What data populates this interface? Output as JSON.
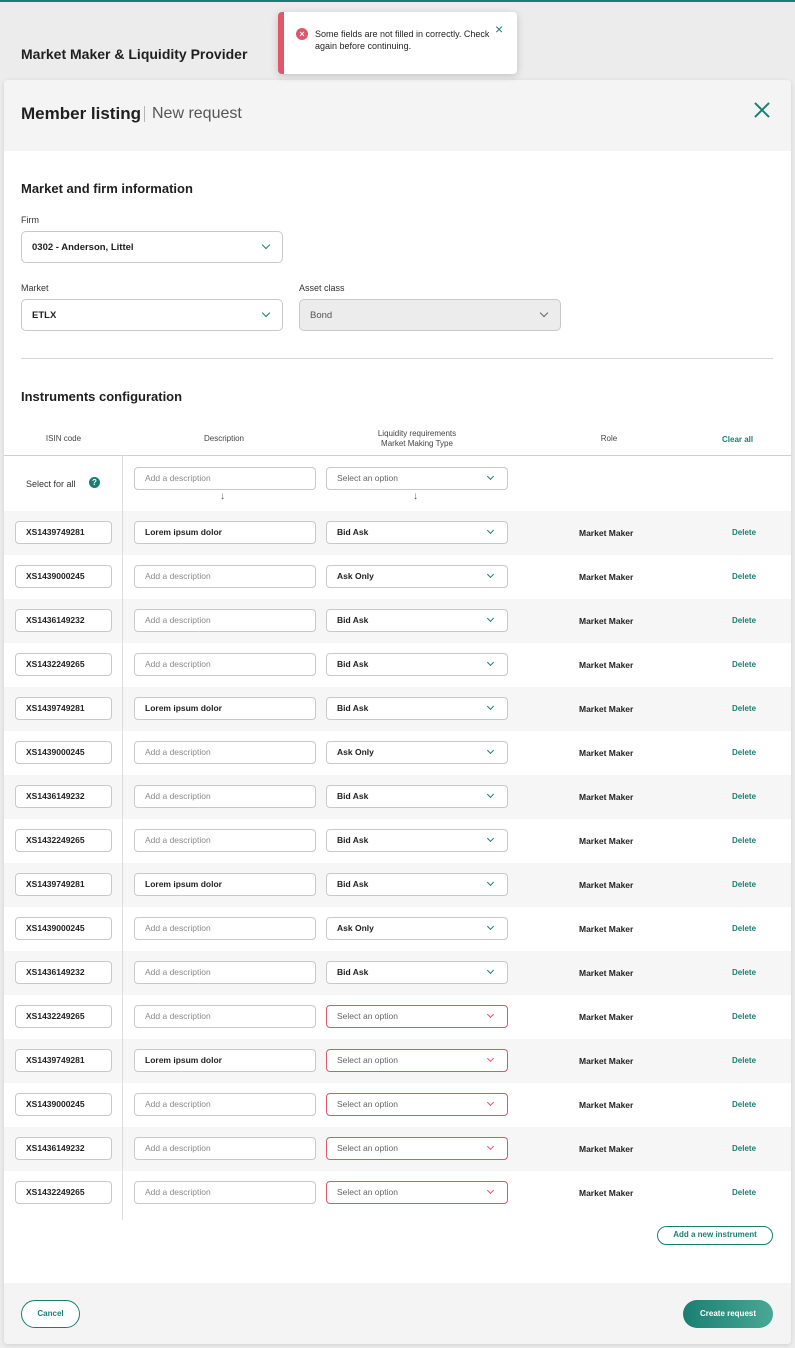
{
  "page": {
    "title": "Market Maker & Liquidity Provider"
  },
  "toast": {
    "message": "Some fields are not filled in correctly. Check again before continuing.",
    "error_icon": "×",
    "close_icon": "×"
  },
  "modal": {
    "title": "Member listing",
    "subtitle": "New request"
  },
  "market_firm": {
    "section_title": "Market and firm information",
    "firm_label": "Firm",
    "firm_value": "0302 - Anderson, Littel",
    "market_label": "Market",
    "market_value": "ETLX",
    "asset_label": "Asset class",
    "asset_value": "Bond"
  },
  "instruments": {
    "section_title": "Instruments configuration",
    "headers": {
      "isin": "ISIN code",
      "description": "Description",
      "liquidity_line1": "Liquidity requirements",
      "liquidity_line2": "Market Making Type",
      "role": "Role",
      "clear_all": "Clear all"
    },
    "select_all": {
      "label": "Select for all",
      "help_icon": "?",
      "desc_placeholder": "Add a description",
      "type_placeholder": "Select an option",
      "arrow": "↓"
    },
    "rows": [
      {
        "isin": "XS1439749281",
        "description": "Lorem ipsum dolor",
        "type": "Bid Ask",
        "role": "Market Maker",
        "delete": "Delete"
      },
      {
        "isin": "XS1439000245",
        "description": "Add a description",
        "type": "Ask Only",
        "role": "Market Maker",
        "delete": "Delete"
      },
      {
        "isin": "XS1436149232",
        "description": "Add a description",
        "type": "Bid Ask",
        "role": "Market Maker",
        "delete": "Delete"
      },
      {
        "isin": "XS1432249265",
        "description": "Add a description",
        "type": "Bid Ask",
        "role": "Market Maker",
        "delete": "Delete"
      },
      {
        "isin": "XS1439749281",
        "description": "Lorem ipsum dolor",
        "type": "Bid Ask",
        "role": "Market Maker",
        "delete": "Delete"
      },
      {
        "isin": "XS1439000245",
        "description": "Add a description",
        "type": "Ask Only",
        "role": "Market Maker",
        "delete": "Delete"
      },
      {
        "isin": "XS1436149232",
        "description": "Add a description",
        "type": "Bid Ask",
        "role": "Market Maker",
        "delete": "Delete"
      },
      {
        "isin": "XS1432249265",
        "description": "Add a description",
        "type": "Bid Ask",
        "role": "Market Maker",
        "delete": "Delete"
      },
      {
        "isin": "XS1439749281",
        "description": "Lorem ipsum dolor",
        "type": "Bid Ask",
        "role": "Market Maker",
        "delete": "Delete"
      },
      {
        "isin": "XS1439000245",
        "description": "Add a description",
        "type": "Ask Only",
        "role": "Market Maker",
        "delete": "Delete"
      },
      {
        "isin": "XS1436149232",
        "description": "Add a description",
        "type": "Bid Ask",
        "role": "Market Maker",
        "delete": "Delete"
      },
      {
        "isin": "XS1432249265",
        "description": "Add a description",
        "type": "Select an option",
        "role": "Market Maker",
        "delete": "Delete"
      },
      {
        "isin": "XS1439749281",
        "description": "Lorem ipsum dolor",
        "type": "Select an option",
        "role": "Market Maker",
        "delete": "Delete"
      },
      {
        "isin": "XS1439000245",
        "description": "Add a description",
        "type": "Select an option",
        "role": "Market Maker",
        "delete": "Delete"
      },
      {
        "isin": "XS1436149232",
        "description": "Add a description",
        "type": "Select an option",
        "role": "Market Maker",
        "delete": "Delete"
      },
      {
        "isin": "XS1432249265",
        "description": "Add a description",
        "type": "Select an option",
        "role": "Market Maker",
        "delete": "Delete"
      }
    ],
    "add_button": "Add a new instrument"
  },
  "footer": {
    "cancel": "Cancel",
    "create": "Create request"
  },
  "colors": {
    "accent": "#1a7f72",
    "error": "#e0566a"
  }
}
